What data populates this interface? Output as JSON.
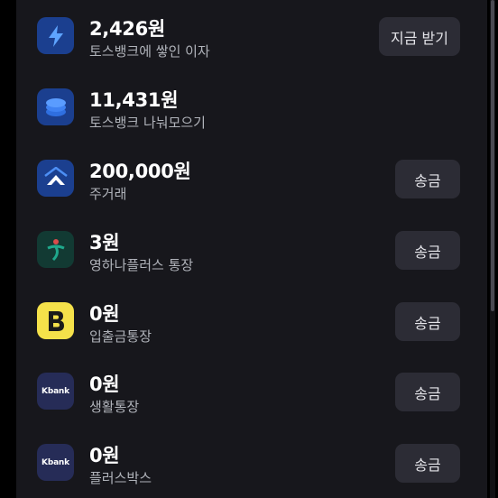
{
  "accounts": [
    {
      "amount": "2,426원",
      "label": "토스뱅크에 쌓인 이자",
      "button": "지금 받기",
      "icon": "lightning-icon",
      "icon_bg": "#1b3f8f"
    },
    {
      "amount": "11,431원",
      "label": "토스뱅크 나눠모으기",
      "button": "",
      "icon": "coin-stack-icon",
      "icon_bg": "#1b3f8f"
    },
    {
      "amount": "200,000원",
      "label": "주거래",
      "button": "송금",
      "icon": "house-arrow-icon",
      "icon_bg": "#1b3f8f"
    },
    {
      "amount": "3원",
      "label": "영하나플러스 통장",
      "button": "송금",
      "icon": "hana-bank-icon",
      "icon_bg": "#123a33"
    },
    {
      "amount": "0원",
      "label": "입출금통장",
      "button": "송금",
      "icon": "kakaobank-b-icon",
      "icon_bg": "#f5e14a"
    },
    {
      "amount": "0원",
      "label": "생활통장",
      "button": "송금",
      "icon": "kbank-icon",
      "icon_bg": "#262c57",
      "icon_text": "Kbank"
    },
    {
      "amount": "0원",
      "label": "플러스박스",
      "button": "송금",
      "icon": "kbank-icon",
      "icon_bg": "#262c57",
      "icon_text": "Kbank"
    }
  ],
  "colors": {
    "background": "#17171c",
    "amount_text": "#ffffff",
    "label_text": "#b0b3ba",
    "button_bg": "#2c2c35"
  }
}
